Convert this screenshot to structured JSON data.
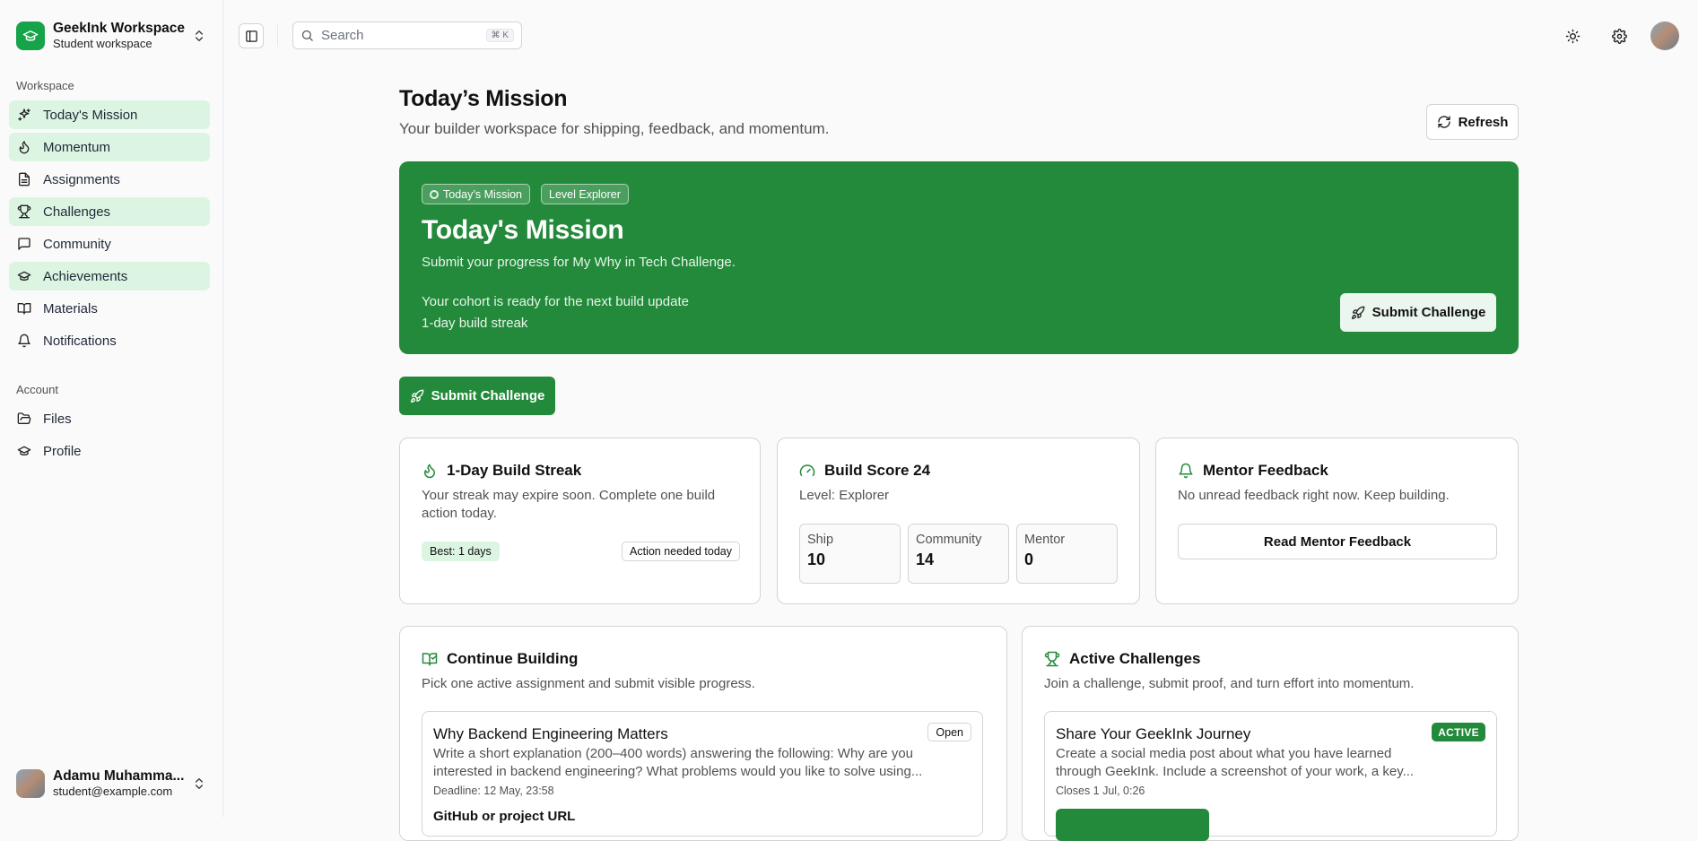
{
  "workspace": {
    "name": "GeekInk Workspace",
    "subtitle": "Student workspace"
  },
  "sidebar": {
    "section_workspace": "Workspace",
    "items": [
      {
        "label": "Today's Mission",
        "icon": "sparkles-icon",
        "active": true
      },
      {
        "label": "Momentum",
        "icon": "flame-icon",
        "active": true
      },
      {
        "label": "Assignments",
        "icon": "file-icon",
        "active": false
      },
      {
        "label": "Challenges",
        "icon": "trophy-icon",
        "active": true
      },
      {
        "label": "Community",
        "icon": "message-icon",
        "active": false
      },
      {
        "label": "Achievements",
        "icon": "graduation-cap-icon",
        "active": true
      },
      {
        "label": "Materials",
        "icon": "book-icon",
        "active": false
      },
      {
        "label": "Notifications",
        "icon": "bell-icon",
        "active": false
      }
    ],
    "section_account": "Account",
    "account_items": [
      {
        "label": "Files",
        "icon": "folder-icon"
      },
      {
        "label": "Profile",
        "icon": "graduation-cap-icon"
      }
    ]
  },
  "user": {
    "name": "Adamu Muhamma...",
    "email": "student@example.com"
  },
  "topbar": {
    "search_placeholder": "Search",
    "search_shortcut": "⌘ K"
  },
  "page": {
    "title": "Today’s Mission",
    "subtitle": "Your builder workspace for shipping, feedback, and momentum.",
    "refresh_label": "Refresh"
  },
  "hero": {
    "chip_mission": "Today’s Mission",
    "chip_level": "Level Explorer",
    "title": "Today's Mission",
    "subtitle": "Submit your progress for My Why in Tech Challenge.",
    "line1": "Your cohort is ready for the next build update",
    "line2": "1-day build streak",
    "button_label": "Submit Challenge"
  },
  "primary_button": "Submit Challenge",
  "streak_card": {
    "title": "1-Day Build Streak",
    "desc": "Your streak may expire soon. Complete one build action today.",
    "best": "Best: 1 days",
    "action": "Action needed today"
  },
  "score_card": {
    "title": "Build Score 24",
    "level": "Level: Explorer",
    "stats": [
      {
        "label": "Ship",
        "value": "10"
      },
      {
        "label": "Community",
        "value": "14"
      },
      {
        "label": "Mentor",
        "value": "0"
      }
    ]
  },
  "mentor_card": {
    "title": "Mentor Feedback",
    "desc": "No unread feedback right now. Keep building.",
    "button": "Read Mentor Feedback"
  },
  "continue_card": {
    "title": "Continue Building",
    "desc": "Pick one active assignment and submit visible progress.",
    "item": {
      "title": "Why Backend Engineering Matters",
      "badge": "Open",
      "desc_line1": "Write a short explanation (200–400 words) answering the following: Why are you",
      "desc_line2": "interested in backend engineering? What problems would you like to solve using...",
      "deadline": "Deadline: 12 May, 23:58",
      "link": "GitHub or project URL"
    }
  },
  "challenges_card": {
    "title": "Active Challenges",
    "desc": "Join a challenge, submit proof, and turn effort into momentum.",
    "item": {
      "title": "Share Your GeekInk Journey",
      "badge": "ACTIVE",
      "desc_line1": "Create a social media post about what you have learned",
      "desc_line2": "through GeekInk. Include a screenshot of your work, a key...",
      "closes": "Closes 1 Jul, 0:26"
    }
  },
  "colors": {
    "brand": "#248a3b",
    "active_nav": "#dcf5e3"
  }
}
